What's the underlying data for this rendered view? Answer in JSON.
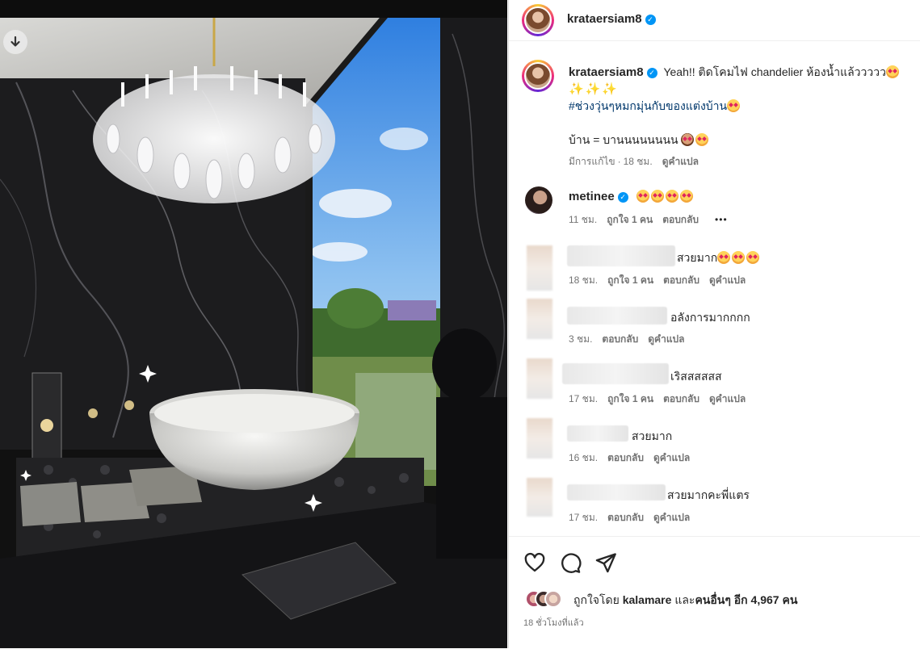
{
  "post": {
    "author": "krataersiam8",
    "caption_text": "Yeah!! ติดโคมไฟ chandelier ห้องน้ำแล้ววววว",
    "hashtag": "#ช่วงวุ่นๆหมกมุ่นกับของแต่งบ้าน",
    "caption_line3": "บ้าน = บานนนนนนนน",
    "caption_meta": {
      "edited": "มีการแก้ไข",
      "separator": "·",
      "time": "18 ชม.",
      "translate": "ดูคำแปล"
    }
  },
  "comments": [
    {
      "username": "metinee",
      "verified": true,
      "time": "11 ชม.",
      "likes": "ถูกใจ 1 คน",
      "reply": "ตอบกลับ",
      "more": "•••"
    },
    {
      "text": "สวยมาก",
      "time": "18 ชม.",
      "likes": "ถูกใจ 1 คน",
      "reply": "ตอบกลับ",
      "translate": "ดูคำแปล"
    },
    {
      "text": "อลังการมากกกก",
      "time": "3 ชม.",
      "reply": "ตอบกลับ",
      "translate": "ดูคำแปล"
    },
    {
      "text": "เริสสสสสส",
      "time": "17 ชม.",
      "likes": "ถูกใจ 1 คน",
      "reply": "ตอบกลับ",
      "translate": "ดูคำแปล"
    },
    {
      "text": "สวยมาก",
      "time": "16 ชม.",
      "reply": "ตอบกลับ",
      "translate": "ดูคำแปล"
    },
    {
      "text": "สวยมากคะพี่แตร",
      "time": "17 ชม.",
      "reply": "ตอบกลับ",
      "translate": "ดูคำแปล"
    }
  ],
  "likes_line": {
    "prefix": "ถูกใจโดย",
    "user": "kalamare",
    "and": "และ",
    "others": "คนอื่นๆ อีก 4,967 คน"
  },
  "posted_ago": "18 ชั่วโมงที่แล้ว",
  "icons": {
    "download": "download-arrow-icon",
    "like": "heart-icon",
    "comment": "comment-bubble-icon",
    "share": "paper-plane-icon",
    "verified": "verified-badge-icon",
    "more": "more-options-icon"
  },
  "colors": {
    "accent": "#0095f6",
    "hashtag": "#00376b",
    "muted": "#737373",
    "text": "#262626"
  }
}
